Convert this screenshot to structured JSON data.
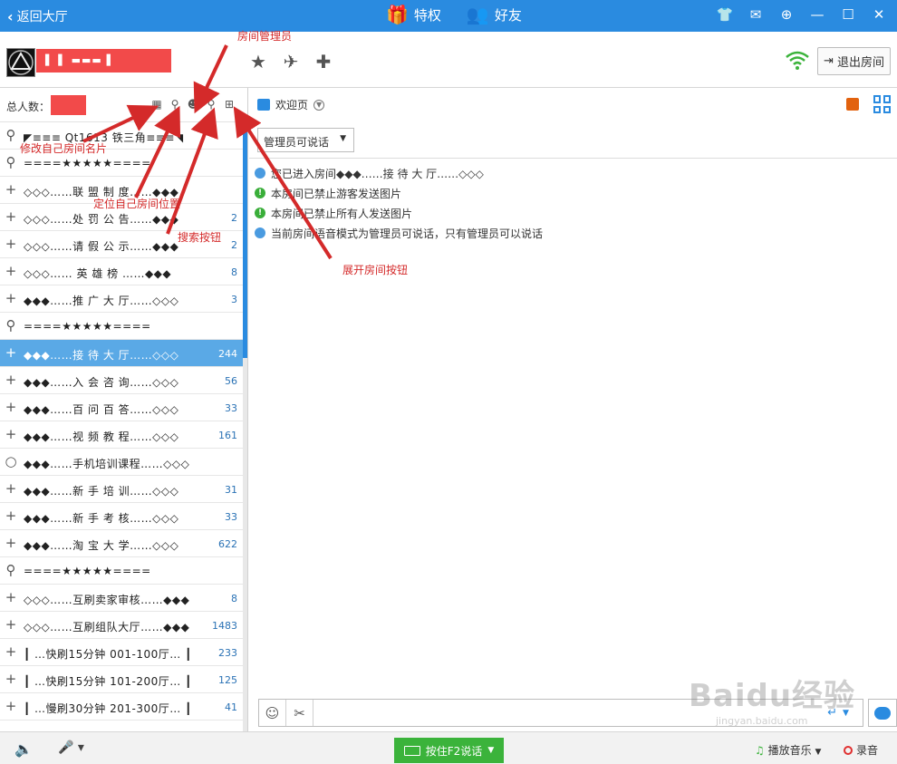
{
  "titlebar": {
    "back_label": "返回大厅",
    "tab_privilege": "特权",
    "tab_friends": "好友",
    "icons": [
      "shirt-icon",
      "message-icon",
      "arrow-circle-icon",
      "minimize-icon",
      "maximize-icon",
      "close-icon"
    ]
  },
  "header": {
    "exit_label": "退出房间",
    "icons": [
      "star-icon",
      "plane-icon",
      "add-user-icon"
    ],
    "wifi_color": "#3bb33b"
  },
  "left": {
    "total_label": "总人数：",
    "rows": [
      {
        "icon": "key-icon",
        "name": "◤≡≡≡ Qt1613  铁三角≡≡≡◥",
        "count": ""
      },
      {
        "icon": "key-icon",
        "name": "====★★★★★====",
        "count": ""
      },
      {
        "icon": "plus-lock-icon",
        "name": "◇◇◇……联 盟 制 度……◆◆◆",
        "count": ""
      },
      {
        "icon": "plus-icon",
        "name": "◇◇◇……处 罚 公 告……◆◆◆",
        "count": "2"
      },
      {
        "icon": "plus-icon",
        "name": "◇◇◇……请 假 公 示……◆◆◆",
        "count": "2"
      },
      {
        "icon": "plus-icon",
        "name": "◇◇◇……  英 雄 榜  ……◆◆◆",
        "count": "8"
      },
      {
        "icon": "plus-icon",
        "name": "◆◆◆……推 广 大 厅……◇◇◇",
        "count": "3"
      },
      {
        "icon": "key-icon",
        "name": "====★★★★★====",
        "count": ""
      },
      {
        "icon": "plus-icon",
        "name": "◆◆◆……接 待 大 厅……◇◇◇",
        "count": "244",
        "selected": true
      },
      {
        "icon": "plus-lock-icon",
        "name": "◆◆◆……入 会 咨 询……◇◇◇",
        "count": "56"
      },
      {
        "icon": "plus-icon",
        "name": "◆◆◆……百 问 百 答……◇◇◇",
        "count": "33"
      },
      {
        "icon": "plus-icon",
        "name": "◆◆◆……视 频 教 程……◇◇◇",
        "count": "161"
      },
      {
        "icon": "circle-icon",
        "name": "◆◆◆……手机培训课程……◇◇◇",
        "count": ""
      },
      {
        "icon": "plus-icon",
        "name": "◆◆◆……新 手 培 训……◇◇◇",
        "count": "31"
      },
      {
        "icon": "plus-icon",
        "name": "◆◆◆……新 手 考 核……◇◇◇",
        "count": "33"
      },
      {
        "icon": "plus-icon",
        "name": "◆◆◆……淘 宝 大 学……◇◇◇",
        "count": "622"
      },
      {
        "icon": "key-icon",
        "name": "====★★★★★====",
        "count": ""
      },
      {
        "icon": "plus-icon",
        "name": "◇◇◇……互刷卖家审核……◆◆◆",
        "count": "8"
      },
      {
        "icon": "plus-icon",
        "name": "◇◇◇……互刷组队大厅……◆◆◆",
        "count": "1483"
      },
      {
        "icon": "plus-icon",
        "name": "┃ …快刷15分钟 001-100厅… ┃",
        "count": "233"
      },
      {
        "icon": "plus-icon",
        "name": "┃ …快刷15分钟 101-200厅… ┃",
        "count": "125"
      },
      {
        "icon": "plus-icon",
        "name": "┃ …慢刷30分钟 201-300厅… ┃",
        "count": "41"
      }
    ]
  },
  "right": {
    "welcome_tab": "欢迎页",
    "mode_select": "管理员可说话",
    "messages": [
      {
        "type": "info",
        "text": "您已进入房间◆◆◆……接 待 大 厅……◇◇◇"
      },
      {
        "type": "notice",
        "text": "本房间已禁止游客发送图片"
      },
      {
        "type": "notice",
        "text": "本房间已禁止所有人发送图片"
      },
      {
        "type": "info",
        "text": "当前房间语音模式为管理员可说话，只有管理员可以说话"
      }
    ]
  },
  "bottom": {
    "ptt_label": "按住F2说话",
    "music_label": "播放音乐",
    "record_label": "录音"
  },
  "annotations": {
    "room_admin": "房间管理员",
    "edit_card": "修改自己房间名片",
    "locate": "定位自己房间位置",
    "search": "搜索按钮",
    "expand": "展开房间按钮"
  },
  "watermark": {
    "brand": "Baidu经验",
    "url": "jingyan.baidu.com"
  }
}
